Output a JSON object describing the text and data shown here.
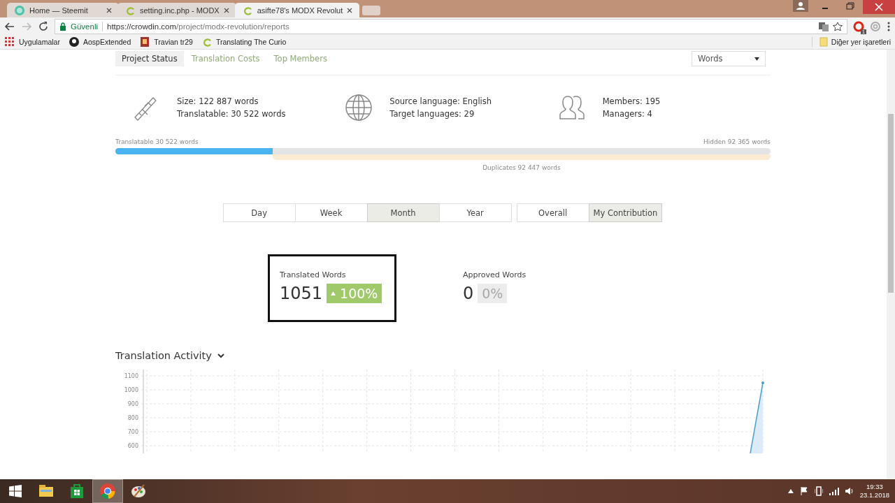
{
  "browser": {
    "tabs": [
      {
        "title": "Home — Steemit",
        "selected": false,
        "kind": "steemit"
      },
      {
        "title": "setting.inc.php - MODX",
        "selected": false,
        "kind": "crowdin"
      },
      {
        "title": "asifte78's MODX Revolut",
        "selected": true,
        "kind": "crowdin"
      }
    ],
    "address": {
      "secure_label": "Güvenli",
      "host": "https://crowdin.com",
      "path": "/project/modx-revolution/reports"
    },
    "extension_badge": "1",
    "bookmarks": [
      {
        "label": "Uygulamalar",
        "kind": "apps"
      },
      {
        "label": "AospExtended",
        "kind": "github"
      },
      {
        "label": "Travian tr29",
        "kind": "travian"
      },
      {
        "label": "Translating The Curio",
        "kind": "crowdin"
      }
    ],
    "other_bookmarks": "Diğer yer işaretleri"
  },
  "report": {
    "tabs": [
      {
        "label": "Project Status",
        "selected": true
      },
      {
        "label": "Translation Costs",
        "selected": false
      },
      {
        "label": "Top Members",
        "selected": false
      }
    ],
    "unit_select": "Words",
    "info": [
      {
        "kind": "caliper",
        "lines": [
          "Size: 122 887 words",
          "Translatable: 30 522 words"
        ]
      },
      {
        "kind": "globe",
        "lines": [
          "Source language: English",
          "Target languages: 29"
        ]
      },
      {
        "kind": "members",
        "lines": [
          "Members: 195",
          "Managers: 4"
        ]
      }
    ],
    "progress": {
      "translatable_label": "Translatable 30 522 words",
      "hidden_label": "Hidden 92 365 words",
      "level": 0.24,
      "duplicates_label": "Duplicates 92 447 words"
    },
    "periods": [
      {
        "label": "Day",
        "selected": false
      },
      {
        "label": "Week",
        "selected": false
      },
      {
        "label": "Month",
        "selected": true
      },
      {
        "label": "Year",
        "selected": false
      }
    ],
    "scopes": [
      {
        "label": "Overall",
        "selected": false
      },
      {
        "label": "My Contribution",
        "selected": true
      }
    ],
    "stats": [
      {
        "label": "Translated Words",
        "value": "1051",
        "change": "100%",
        "kind": "up",
        "highlighted": true
      },
      {
        "label": "Approved Words",
        "value": "0",
        "change": "0%",
        "kind": "flat",
        "highlighted": false
      }
    ],
    "activity": {
      "title": "Translation Activity",
      "y_axis_labels": [
        "1100",
        "1000",
        "900",
        "800",
        "700",
        "600"
      ]
    }
  },
  "taskbar": {
    "apps": [
      {
        "kind": "explorer",
        "active": false
      },
      {
        "kind": "store",
        "active": false
      },
      {
        "kind": "chrome",
        "active": true
      },
      {
        "kind": "paint",
        "active": false
      }
    ],
    "time": "19:33",
    "date": "23.1.2018"
  }
}
